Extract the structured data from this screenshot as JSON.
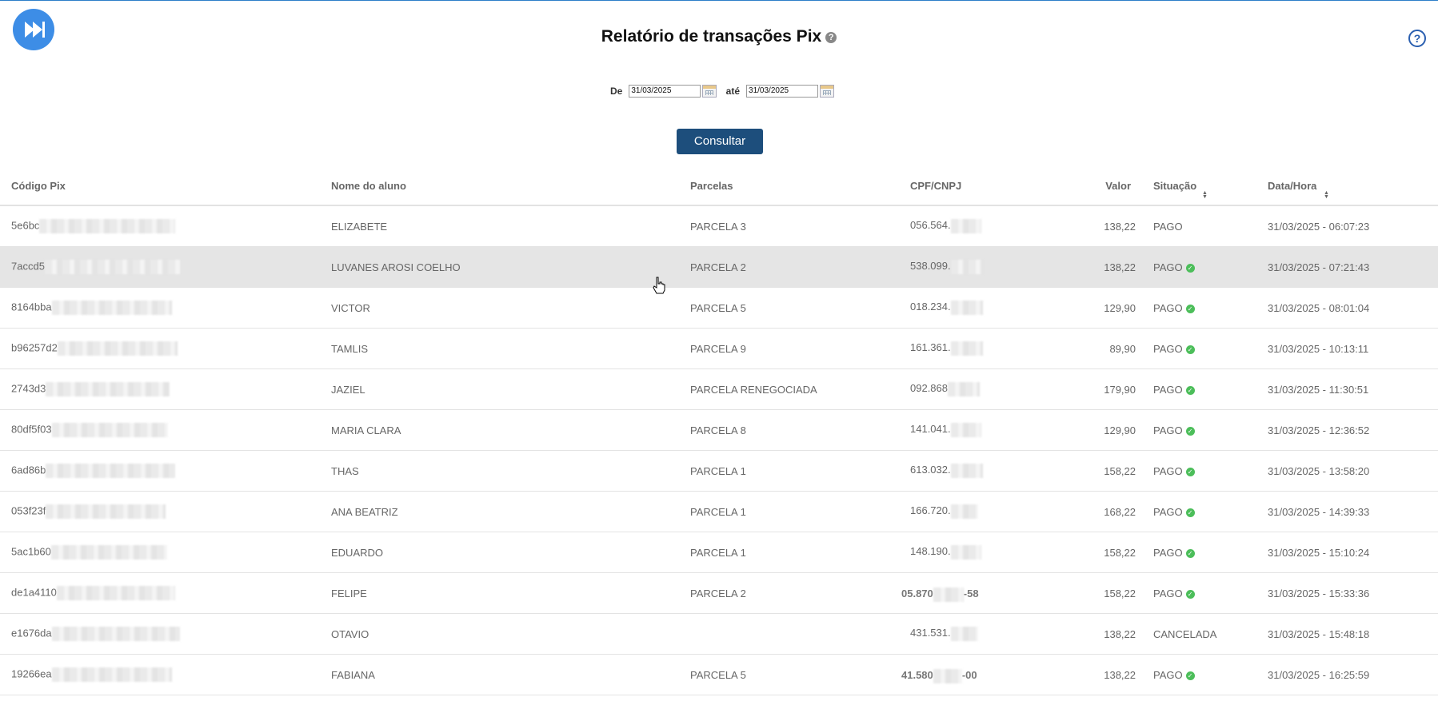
{
  "header": {
    "title": "Relatório de transações Pix",
    "title_help_glyph": "?",
    "help_glyph": "?"
  },
  "filter": {
    "from_label": "De",
    "from_value": "31/03/2025",
    "to_label": "até",
    "to_value": "31/03/2025",
    "submit_label": "Consultar"
  },
  "table": {
    "columns": [
      "Código Pix",
      "Nome do aluno",
      "Parcelas",
      "CPF/CNPJ",
      "Valor",
      "Situação",
      "Data/Hora"
    ],
    "rows": [
      {
        "code": "5e6bc",
        "name": "ELIZABETE",
        "parcela": "PARCELA 3",
        "cpf": "056.564.",
        "cpf_suffix": "",
        "cpf_bold": false,
        "valor": "138,22",
        "status": "PAGO",
        "status_ok": false,
        "datetime": "31/03/2025 - 06:07:23"
      },
      {
        "code": "7accd5",
        "name": "LUVANES AROSI COELHO",
        "parcela": "PARCELA 2",
        "cpf": "538.099.",
        "cpf_suffix": "",
        "cpf_bold": false,
        "valor": "138,22",
        "status": "PAGO",
        "status_ok": true,
        "datetime": "31/03/2025 - 07:21:43"
      },
      {
        "code": "8164bba",
        "name": "VICTOR",
        "parcela": "PARCELA 5",
        "cpf": "018.234.",
        "cpf_suffix": "",
        "cpf_bold": false,
        "valor": "129,90",
        "status": "PAGO",
        "status_ok": true,
        "datetime": "31/03/2025 - 08:01:04"
      },
      {
        "code": "b96257d2",
        "name": "TAMLIS",
        "parcela": "PARCELA 9",
        "cpf": "161.361.",
        "cpf_suffix": "",
        "cpf_bold": false,
        "valor": "89,90",
        "status": "PAGO",
        "status_ok": true,
        "datetime": "31/03/2025 - 10:13:11"
      },
      {
        "code": "2743d3",
        "name": "JAZIEL",
        "parcela": "PARCELA RENEGOCIADA",
        "cpf": "092.868",
        "cpf_suffix": "",
        "cpf_bold": false,
        "valor": "179,90",
        "status": "PAGO",
        "status_ok": true,
        "datetime": "31/03/2025 - 11:30:51"
      },
      {
        "code": "80df5f03",
        "name": "MARIA CLARA",
        "parcela": "PARCELA 8",
        "cpf": "141.041.",
        "cpf_suffix": "",
        "cpf_bold": false,
        "valor": "129,90",
        "status": "PAGO",
        "status_ok": true,
        "datetime": "31/03/2025 - 12:36:52"
      },
      {
        "code": "6ad86b",
        "name": "THAS",
        "parcela": "PARCELA 1",
        "cpf": "613.032.",
        "cpf_suffix": "",
        "cpf_bold": false,
        "valor": "158,22",
        "status": "PAGO",
        "status_ok": true,
        "datetime": "31/03/2025 - 13:58:20"
      },
      {
        "code": "053f23f",
        "name": "ANA BEATRIZ",
        "parcela": "PARCELA 1",
        "cpf": "166.720.",
        "cpf_suffix": "",
        "cpf_bold": false,
        "valor": "168,22",
        "status": "PAGO",
        "status_ok": true,
        "datetime": "31/03/2025 - 14:39:33"
      },
      {
        "code": "5ac1b60",
        "name": "EDUARDO",
        "parcela": "PARCELA 1",
        "cpf": "148.190.",
        "cpf_suffix": "",
        "cpf_bold": false,
        "valor": "158,22",
        "status": "PAGO",
        "status_ok": true,
        "datetime": "31/03/2025 - 15:10:24"
      },
      {
        "code": "de1a4110",
        "name": "FELIPE",
        "parcela": "PARCELA 2",
        "cpf": "05.870",
        "cpf_suffix": "-58",
        "cpf_bold": true,
        "valor": "158,22",
        "status": "PAGO",
        "status_ok": true,
        "datetime": "31/03/2025 - 15:33:36"
      },
      {
        "code": "e1676da",
        "name": "OTAVIO",
        "parcela": "",
        "cpf": "431.531.",
        "cpf_suffix": "",
        "cpf_bold": false,
        "valor": "138,22",
        "status": "CANCELADA",
        "status_ok": false,
        "datetime": "31/03/2025 - 15:48:18"
      },
      {
        "code": "19266ea",
        "name": "FABIANA",
        "parcela": "PARCELA 5",
        "cpf": "41.580",
        "cpf_suffix": "-00",
        "cpf_bold": true,
        "valor": "138,22",
        "status": "PAGO",
        "status_ok": true,
        "datetime": "31/03/2025 - 16:25:59"
      }
    ],
    "highlighted_row": 1
  },
  "colors": {
    "button": "#1d4e7c",
    "logo": "#3d8de6",
    "ok": "#4cbe5a",
    "highlight": "#e5e5e5"
  }
}
